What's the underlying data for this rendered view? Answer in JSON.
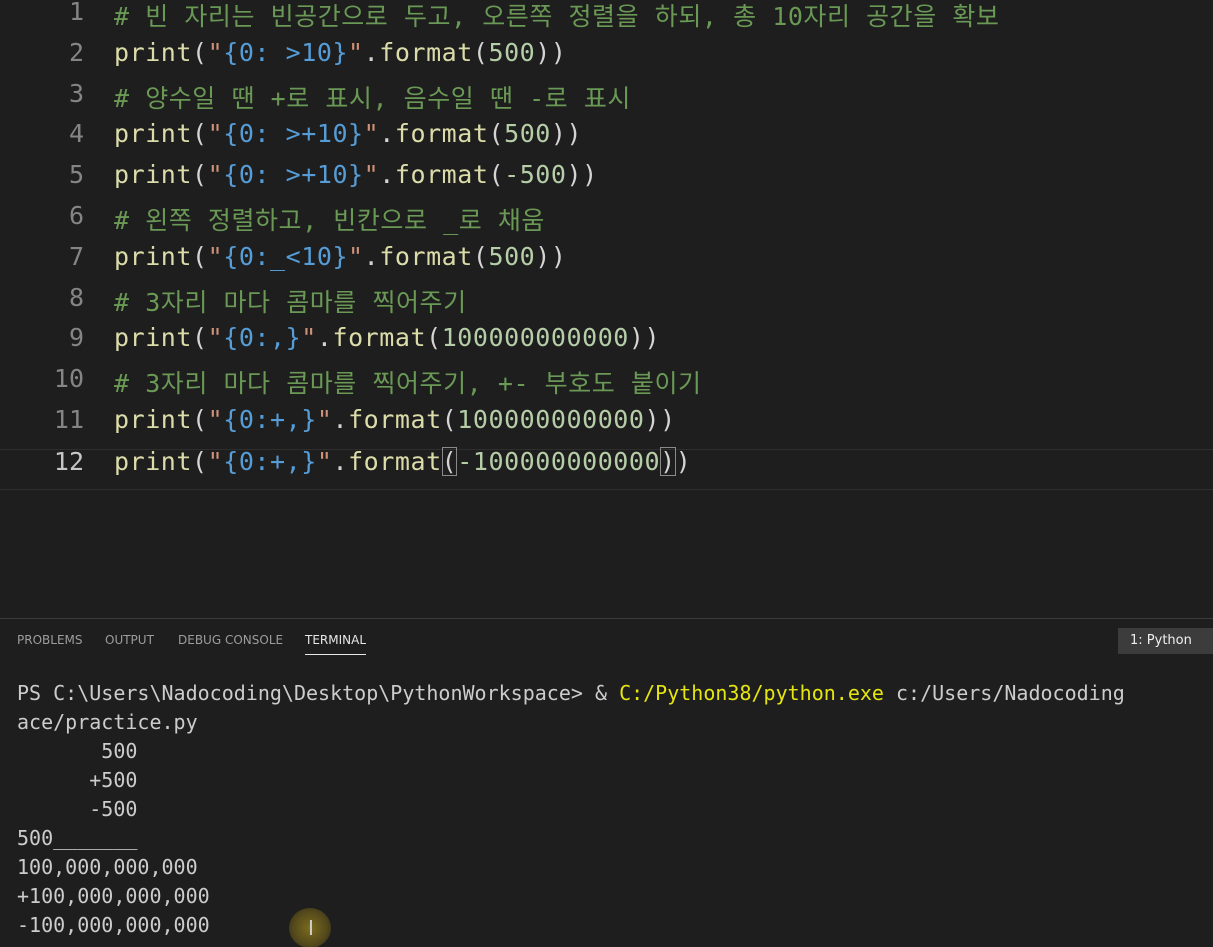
{
  "editor": {
    "lines": [
      {
        "number": "1",
        "tokens": [
          {
            "t": "# 빈 자리는 빈공간으로 두고, 오른쪽 정렬을 하되, 총 10자리 공간을 확보",
            "c": "cm"
          }
        ]
      },
      {
        "number": "2",
        "tokens": [
          {
            "t": "print",
            "c": "fn"
          },
          {
            "t": "(",
            "c": "pn"
          },
          {
            "t": "\"",
            "c": "st"
          },
          {
            "t": "{0: >10}",
            "c": "sp"
          },
          {
            "t": "\"",
            "c": "st"
          },
          {
            "t": ".",
            "c": "pn"
          },
          {
            "t": "format",
            "c": "fn"
          },
          {
            "t": "(",
            "c": "pn"
          },
          {
            "t": "500",
            "c": "nm"
          },
          {
            "t": "))",
            "c": "pn"
          }
        ]
      },
      {
        "number": "3",
        "tokens": [
          {
            "t": "# 양수일 땐 +로 표시, 음수일 땐 -로 표시",
            "c": "cm"
          }
        ]
      },
      {
        "number": "4",
        "tokens": [
          {
            "t": "print",
            "c": "fn"
          },
          {
            "t": "(",
            "c": "pn"
          },
          {
            "t": "\"",
            "c": "st"
          },
          {
            "t": "{0: >+10}",
            "c": "sp"
          },
          {
            "t": "\"",
            "c": "st"
          },
          {
            "t": ".",
            "c": "pn"
          },
          {
            "t": "format",
            "c": "fn"
          },
          {
            "t": "(",
            "c": "pn"
          },
          {
            "t": "500",
            "c": "nm"
          },
          {
            "t": "))",
            "c": "pn"
          }
        ]
      },
      {
        "number": "5",
        "tokens": [
          {
            "t": "print",
            "c": "fn"
          },
          {
            "t": "(",
            "c": "pn"
          },
          {
            "t": "\"",
            "c": "st"
          },
          {
            "t": "{0: >+10}",
            "c": "sp"
          },
          {
            "t": "\"",
            "c": "st"
          },
          {
            "t": ".",
            "c": "pn"
          },
          {
            "t": "format",
            "c": "fn"
          },
          {
            "t": "(",
            "c": "pn"
          },
          {
            "t": "-500",
            "c": "nm"
          },
          {
            "t": "))",
            "c": "pn"
          }
        ]
      },
      {
        "number": "6",
        "tokens": [
          {
            "t": "# 왼쪽 정렬하고, 빈칸으로 _로 채움",
            "c": "cm"
          }
        ]
      },
      {
        "number": "7",
        "tokens": [
          {
            "t": "print",
            "c": "fn"
          },
          {
            "t": "(",
            "c": "pn"
          },
          {
            "t": "\"",
            "c": "st"
          },
          {
            "t": "{0:_<10}",
            "c": "sp"
          },
          {
            "t": "\"",
            "c": "st"
          },
          {
            "t": ".",
            "c": "pn"
          },
          {
            "t": "format",
            "c": "fn"
          },
          {
            "t": "(",
            "c": "pn"
          },
          {
            "t": "500",
            "c": "nm"
          },
          {
            "t": "))",
            "c": "pn"
          }
        ]
      },
      {
        "number": "8",
        "tokens": [
          {
            "t": "# 3자리 마다 콤마를 찍어주기",
            "c": "cm"
          }
        ]
      },
      {
        "number": "9",
        "tokens": [
          {
            "t": "print",
            "c": "fn"
          },
          {
            "t": "(",
            "c": "pn"
          },
          {
            "t": "\"",
            "c": "st"
          },
          {
            "t": "{0:,}",
            "c": "sp"
          },
          {
            "t": "\"",
            "c": "st"
          },
          {
            "t": ".",
            "c": "pn"
          },
          {
            "t": "format",
            "c": "fn"
          },
          {
            "t": "(",
            "c": "pn"
          },
          {
            "t": "100000000000",
            "c": "nm"
          },
          {
            "t": "))",
            "c": "pn"
          }
        ]
      },
      {
        "number": "10",
        "tokens": [
          {
            "t": "# 3자리 마다 콤마를 찍어주기, +- 부호도 붙이기",
            "c": "cm"
          }
        ]
      },
      {
        "number": "11",
        "tokens": [
          {
            "t": "print",
            "c": "fn"
          },
          {
            "t": "(",
            "c": "pn"
          },
          {
            "t": "\"",
            "c": "st"
          },
          {
            "t": "{0:+,}",
            "c": "sp"
          },
          {
            "t": "\"",
            "c": "st"
          },
          {
            "t": ".",
            "c": "pn"
          },
          {
            "t": "format",
            "c": "fn"
          },
          {
            "t": "(",
            "c": "pn"
          },
          {
            "t": "100000000000",
            "c": "nm"
          },
          {
            "t": "))",
            "c": "pn"
          }
        ]
      },
      {
        "number": "12",
        "current": true,
        "tokens": [
          {
            "t": "print",
            "c": "fn"
          },
          {
            "t": "(",
            "c": "pn"
          },
          {
            "t": "\"",
            "c": "st"
          },
          {
            "t": "{0:+,}",
            "c": "sp"
          },
          {
            "t": "\"",
            "c": "st"
          },
          {
            "t": ".",
            "c": "pn"
          },
          {
            "t": "format",
            "c": "fn"
          },
          {
            "t": "(",
            "c": "br"
          },
          {
            "t": "-100000000000",
            "c": "nm"
          },
          {
            "t": ")",
            "c": "br"
          },
          {
            "t": ")",
            "c": "pn"
          }
        ]
      }
    ]
  },
  "panel": {
    "tabs": [
      {
        "label": "PROBLEMS",
        "active": false
      },
      {
        "label": "OUTPUT",
        "active": false
      },
      {
        "label": "DEBUG CONSOLE",
        "active": false
      },
      {
        "label": "TERMINAL",
        "active": true
      }
    ],
    "terminal_selector": "1: Python"
  },
  "terminal": {
    "prompt": "PS C:\\Users\\Nadocoding\\Desktop\\PythonWorkspace> ",
    "command_operator": "& ",
    "command_exe": "C:/Python38/python.exe",
    "command_arg": " c:/Users/Nadocoding",
    "command_arg_wrap": "ace/practice.py",
    "output": [
      "       500",
      "      +500",
      "      -500",
      "500_______",
      "100,000,000,000",
      "+100,000,000,000",
      "-100,000,000,000"
    ]
  },
  "mouse_cursor": "I",
  "colors": {
    "background": "#1e1e1e",
    "comment": "#6a9955",
    "function": "#dcdcaa",
    "string": "#ce9178",
    "format_spec": "#569cd6",
    "number": "#b5cea8",
    "terminal_text": "#cccccc",
    "terminal_exe": "#e5e510"
  }
}
